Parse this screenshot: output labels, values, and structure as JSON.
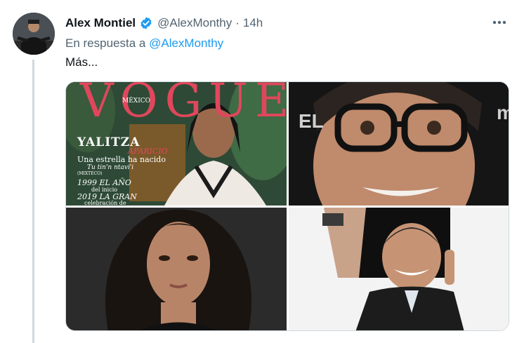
{
  "tweet": {
    "author_name": "Alex Montiel",
    "handle": "@AlexMonthy",
    "separator": "·",
    "time": "14h",
    "reply_prefix": "En respuesta a",
    "reply_mention": "@AlexMonthy",
    "text": "Más..."
  },
  "icons": {
    "verified": "verified-badge-icon",
    "more": "more-options-icon"
  },
  "colors": {
    "link": "#1d9bf0",
    "secondary_text": "#536471",
    "verified": "#1d9bf0"
  },
  "media": {
    "photo1": {
      "magazine": "VOGUE",
      "edition": "MÉXICO",
      "name": "YALITZA",
      "surname": "APARICIO",
      "line1": "Una estrella ha nacido",
      "line2": "Tu tin'n ntavi'i",
      "line3": "(MIXTECO)",
      "line4": "1999 EL AÑO",
      "line5": "del inicio",
      "line6": "2019 LA GRAN",
      "line7": "celebración de"
    },
    "photo2": {
      "bg_letters": "EL",
      "bg_right": "m"
    },
    "photo3": {},
    "photo4": {}
  }
}
